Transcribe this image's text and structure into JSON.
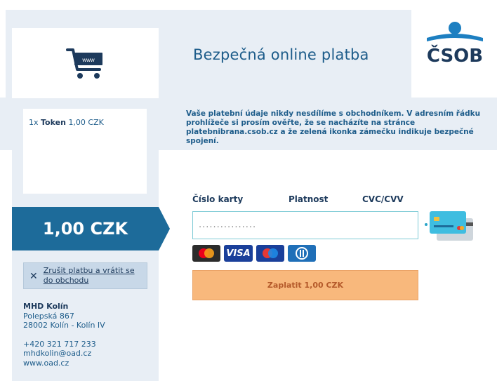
{
  "header": {
    "title": "Bezpečná online platba",
    "logo_text": "ČSOB",
    "cart_badge": "www"
  },
  "order": {
    "quantity": "1x",
    "item": "Token",
    "price": "1,00 CZK"
  },
  "security_note": "Vaše platební údaje nikdy nesdílíme s obchodníkem. V adresním řádku prohlížeče si prosím ověřte, že se nacházíte na stránce platebnibrana.csob.cz a že zelená ikonka zámečku indikuje bezpečné spojení.",
  "amount": "1,00 CZK",
  "cancel": {
    "label": "Zrušit platbu a vrátit se do obchodu"
  },
  "merchant": {
    "name": "MHD Kolín",
    "street": "Polepská 867",
    "city": "28002 Kolín - Kolín IV",
    "phone": "+420 321 717 233",
    "email": "mhdkolin@oad.cz",
    "web": "www.oad.cz"
  },
  "form": {
    "card_number_label": "Číslo karty",
    "expiry_label": "Platnost",
    "cvc_label": "CVC/CVV",
    "card_number_placeholder": "................",
    "pay_button": "Zaplatit 1,00 CZK"
  },
  "brands": {
    "visa": "VISA"
  },
  "colors": {
    "primary": "#1d6b9a",
    "pay_button": "#f8b87c",
    "panel": "#e8eef5"
  }
}
